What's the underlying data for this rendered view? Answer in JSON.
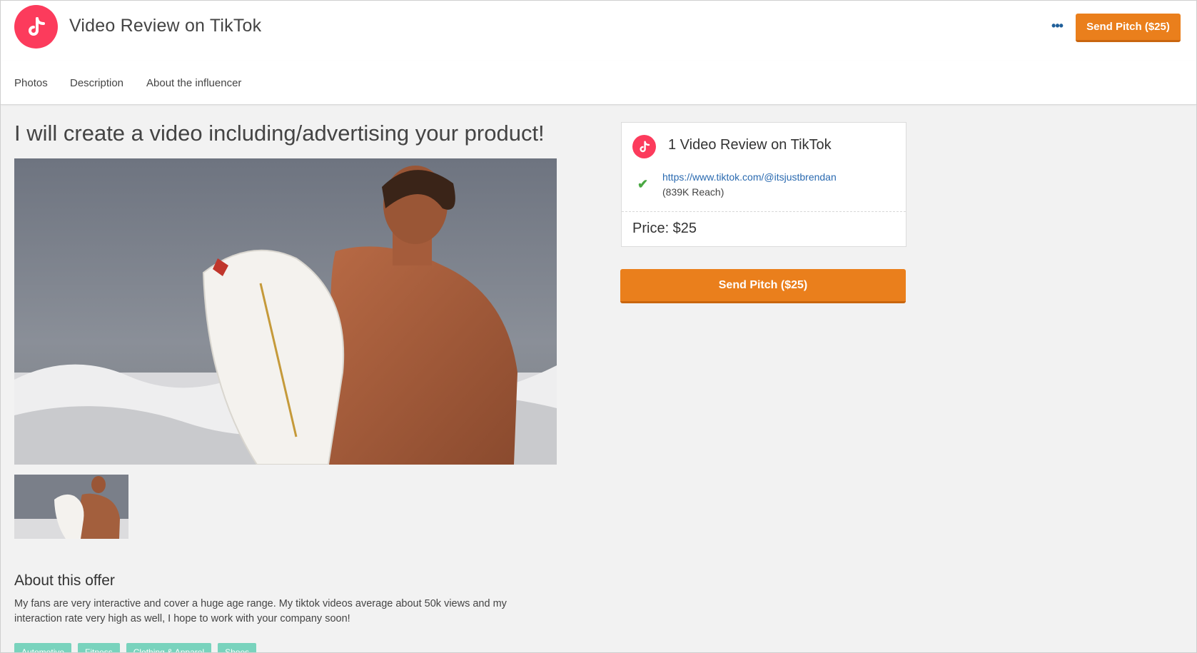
{
  "header": {
    "title": "Video Review on TikTok",
    "more_label": "•••",
    "pitch_button": "Send Pitch ($25)"
  },
  "tabs": [
    {
      "label": "Photos"
    },
    {
      "label": "Description"
    },
    {
      "label": "About the influencer"
    }
  ],
  "offer": {
    "title": "I will create a video including/advertising your product!",
    "about_title": "About this offer",
    "about_text": "My fans are very interactive and cover a huge age range. My tiktok videos average about 50k views and my interaction rate very high as well, I hope to work with your company soon!",
    "tags": [
      "Automotive",
      "Fitness",
      "Clothing & Apparel",
      "Shoes"
    ]
  },
  "card": {
    "title": "1 Video Review on TikTok",
    "link": "https://www.tiktok.com/@itsjustbrendan",
    "reach": "(839K Reach)",
    "price": "Price: $25"
  },
  "main_pitch_button": "Send Pitch ($25)",
  "colors": {
    "brand_pink": "#fc3b5c",
    "accent_orange": "#ea7f1c",
    "link_blue": "#2a6ab0",
    "tag_teal": "#79d3bd",
    "check_green": "#4aa843"
  },
  "icons": {
    "logo": "tiktok-icon",
    "verified": "check-icon",
    "more": "more-dots-icon"
  }
}
